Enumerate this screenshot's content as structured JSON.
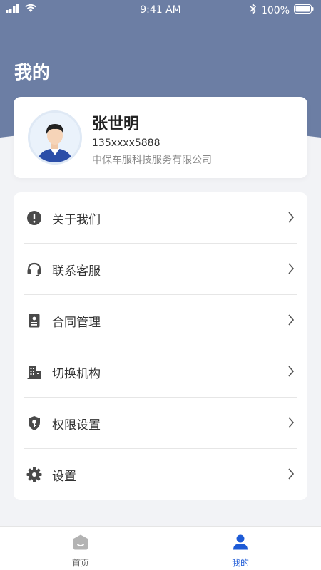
{
  "status_bar": {
    "time": "9:41 AM",
    "battery": "100%"
  },
  "page_title": "我的",
  "profile": {
    "name": "张世明",
    "phone": "135xxxx5888",
    "company": "中保车服科技服务有限公司"
  },
  "menu": {
    "items": [
      {
        "label": "关于我们",
        "icon": "info-icon"
      },
      {
        "label": "联系客服",
        "icon": "headset-icon"
      },
      {
        "label": "合同管理",
        "icon": "contract-icon"
      },
      {
        "label": "切换机构",
        "icon": "building-icon"
      },
      {
        "label": "权限设置",
        "icon": "shield-key-icon"
      },
      {
        "label": "设置",
        "icon": "gear-icon"
      }
    ]
  },
  "tabbar": {
    "home_label": "首页",
    "mine_label": "我的",
    "active_color": "#1e5bd6",
    "inactive_color": "#666666"
  },
  "colors": {
    "header": "#6c7ea4",
    "background": "#f2f3f6"
  }
}
